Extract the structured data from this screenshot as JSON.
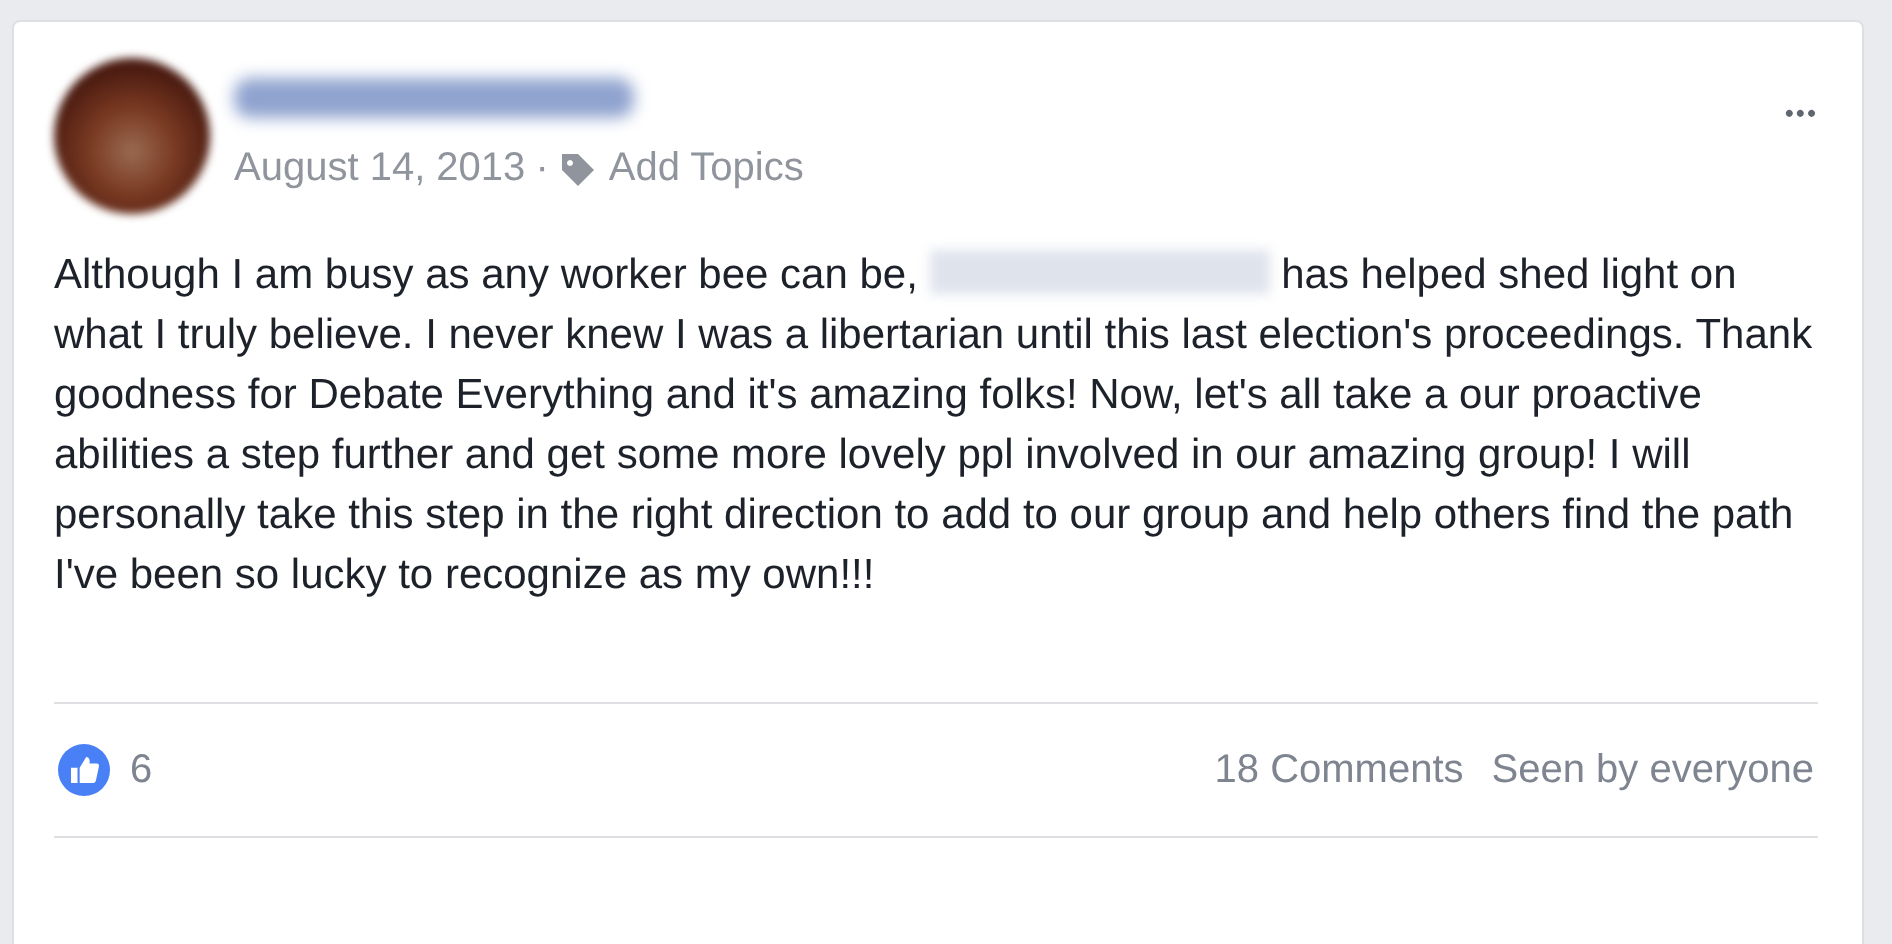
{
  "post": {
    "date": "August 14, 2013",
    "separator": "·",
    "topics_link": "Add Topics",
    "more": "•••",
    "text_before": "Although I am busy as any worker bee can be,",
    "text_after": "has helped shed light on what I truly believe. I never knew I was a libertarian until this last election's proceedings. Thank goodness for Debate Everything and it's amazing folks! Now, let's all take a our proactive abilities a step further and get some more lovely ppl involved in our amazing group! I will personally take this step in the right direction to add to our group and help others find the path I've been so lucky to recognize as my own!!!",
    "likes": "6",
    "comments": "18 Comments",
    "seen": "Seen by everyone"
  }
}
